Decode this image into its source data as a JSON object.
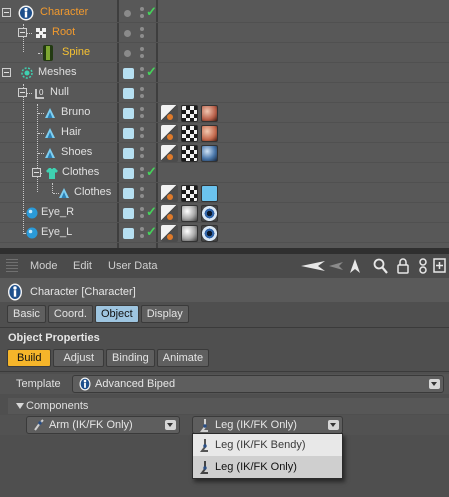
{
  "object_manager": {
    "objects": [
      {
        "label": "Character",
        "color": "#f29a2e"
      },
      {
        "label": "Root",
        "color": "#f29a2e"
      },
      {
        "label": "Spine",
        "color": "#f7c232"
      },
      {
        "label": "Meshes",
        "color": "#e0e0e0"
      },
      {
        "label": "Null",
        "color": "#e0e0e0"
      },
      {
        "label": "Bruno",
        "color": "#e0e0e0"
      },
      {
        "label": "Hair",
        "color": "#e0e0e0"
      },
      {
        "label": "Shoes",
        "color": "#e0e0e0"
      },
      {
        "label": "Clothes",
        "color": "#e0e0e0"
      },
      {
        "label": "Clothes",
        "color": "#e0e0e0"
      },
      {
        "label": "Eye_R",
        "color": "#e0e0e0"
      },
      {
        "label": "Eye_L",
        "color": "#e0e0e0"
      }
    ]
  },
  "attribute_manager": {
    "menu": [
      "Mode",
      "Edit",
      "User Data"
    ],
    "object_title": "Character [Character]",
    "top_tabs": [
      "Basic",
      "Coord.",
      "Object",
      "Display"
    ],
    "active_top_tab": "Object",
    "section_title": "Object Properties",
    "sub_tabs": [
      "Build",
      "Adjust",
      "Binding",
      "Animate"
    ],
    "active_sub_tab": "Build",
    "template_label": "Template",
    "template_value": "Advanced Biped",
    "components_label": "Components",
    "arm_value": "Arm (IK/FK Only)",
    "leg_value": "Leg (IK/FK Only)",
    "popup_options": [
      "Leg (IK/FK Bendy)",
      "Leg (IK/FK Only)"
    ],
    "popup_selected": "Leg (IK/FK Only)"
  },
  "colors": {
    "accent_blue": "#9ec5e0",
    "accent_orange": "#f5b52a",
    "check_green": "#45d35a",
    "object_orange": "#f29a2e"
  }
}
